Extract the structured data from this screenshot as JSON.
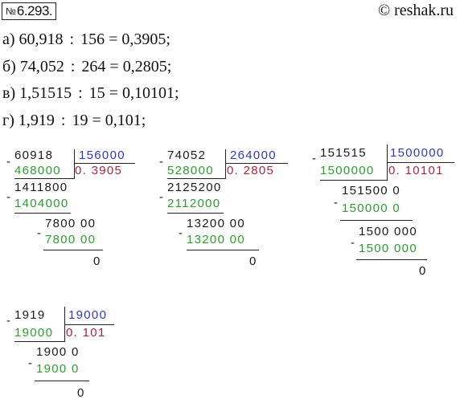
{
  "header": {
    "number_sign": "№",
    "problem_number": "6.293.",
    "site": "© reshak.ru"
  },
  "equations": [
    {
      "label": "а)",
      "dividend": "60,918",
      "op": ":",
      "divisor": "156",
      "eq": "=",
      "result": "0,3905;"
    },
    {
      "label": "б)",
      "dividend": "74,052",
      "op": ":",
      "divisor": "264",
      "eq": "=",
      "result": "0,2805;"
    },
    {
      "label": "в)",
      "dividend": "1,51515",
      "op": ":",
      "divisor": "15",
      "eq": "=",
      "result": "0,10101;"
    },
    {
      "label": "г)",
      "dividend": "1,919",
      "op": ":",
      "divisor": "19",
      "eq": "=",
      "result": "0,101;"
    }
  ],
  "divisions": [
    {
      "dividend": "60918",
      "divisor": "156000",
      "quotient": "0. 3905",
      "sub1": "468000",
      "rem1": "1411800",
      "sub2": "1404000",
      "rem2": "7800 00",
      "sub3": "7800 00",
      "final": "0"
    },
    {
      "dividend": "74052",
      "divisor": "264000",
      "quotient": "0. 2805",
      "sub1": "528000",
      "rem1": "2125200",
      "sub2": "2112000",
      "rem2": "13200 00",
      "sub3": "13200 00",
      "final": "0"
    },
    {
      "dividend": "151515",
      "divisor": "1500000",
      "quotient": "0. 10101",
      "sub1": "1500000",
      "rem1": "151500 0",
      "sub2": "150000 0",
      "rem2": "1500 000",
      "sub3": "1500 000",
      "final": "0"
    },
    {
      "dividend": "1919",
      "divisor": "19000",
      "quotient": "0. 101",
      "sub1": "19000",
      "rem1": "1900 0",
      "sub2": "1900 0",
      "final": "0"
    }
  ],
  "minus_sign": "-"
}
